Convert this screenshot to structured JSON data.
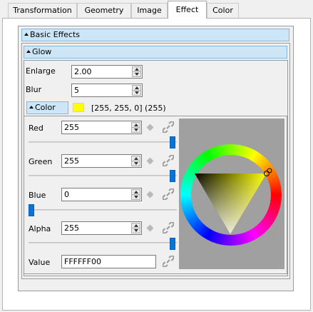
{
  "tabs": [
    {
      "label": "Transformation",
      "active": false
    },
    {
      "label": "Geometry",
      "active": false
    },
    {
      "label": "Image",
      "active": false
    },
    {
      "label": "Effect",
      "active": true
    },
    {
      "label": "Color",
      "active": false
    }
  ],
  "sections": {
    "basic_effects": "Basic Effects",
    "glow": "Glow",
    "color": "Color"
  },
  "glow": {
    "enlarge_label": "Enlarge",
    "enlarge_value": "2.00",
    "blur_label": "Blur",
    "blur_value": "5"
  },
  "color_summary": "[255, 255, 0] (255)",
  "swatch_color": "#ffff00",
  "channels": [
    {
      "label": "Red",
      "value": "255",
      "level": 1.0
    },
    {
      "label": "Green",
      "value": "255",
      "level": 1.0
    },
    {
      "label": "Blue",
      "value": "0",
      "level": 0.0
    },
    {
      "label": "Alpha",
      "value": "255",
      "level": 1.0
    }
  ],
  "value_field": {
    "label": "Value",
    "value": "FFFFFF00"
  },
  "icons": {
    "spin": "up-down-arrows-icon",
    "keyframe": "diamond-icon",
    "link": "chain-link-icon",
    "collapse": "triangle-up-icon"
  }
}
